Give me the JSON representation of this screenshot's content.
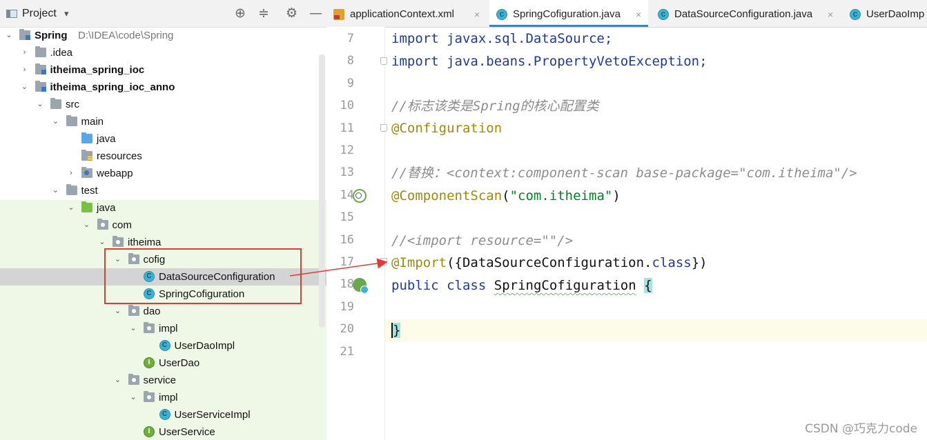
{
  "project_panel": {
    "title": "Project",
    "dropdown": "▾",
    "buttons": {
      "locate": "⊕",
      "collapse": "≑",
      "settings": "⚙",
      "hide": "—"
    },
    "tree": [
      {
        "label": "Spring",
        "path": "D:\\IDEA\\code\\Spring",
        "bold": true,
        "arrow": "⌄",
        "icon": "module",
        "indent": 0
      },
      {
        "label": ".idea",
        "arrow": "›",
        "icon": "folder",
        "indent": 1
      },
      {
        "label": "itheima_spring_ioc",
        "bold": true,
        "arrow": "›",
        "icon": "module",
        "indent": 1
      },
      {
        "label": "itheima_spring_ioc_anno",
        "bold": true,
        "arrow": "⌄",
        "icon": "module",
        "indent": 1
      },
      {
        "label": "src",
        "arrow": "⌄",
        "icon": "folder",
        "indent": 2
      },
      {
        "label": "main",
        "arrow": "⌄",
        "icon": "folder",
        "indent": 3
      },
      {
        "label": "java",
        "icon": "folder-blue",
        "indent": 4
      },
      {
        "label": "resources",
        "icon": "res",
        "indent": 4
      },
      {
        "label": "webapp",
        "arrow": "›",
        "icon": "web",
        "indent": 4
      },
      {
        "label": "test",
        "arrow": "⌄",
        "icon": "folder",
        "indent": 3
      },
      {
        "label": "java",
        "arrow": "⌄",
        "icon": "folder-green",
        "indent": 4
      },
      {
        "label": "com",
        "arrow": "⌄",
        "icon": "pkg",
        "indent": 5
      },
      {
        "label": "itheima",
        "arrow": "⌄",
        "icon": "pkg",
        "indent": 6
      },
      {
        "label": "cofig",
        "arrow": "⌄",
        "icon": "pkg",
        "indent": 7
      },
      {
        "label": "DataSourceConfiguration",
        "icon": "class",
        "indent": 8,
        "selected": true
      },
      {
        "label": "SpringCofiguration",
        "icon": "class",
        "indent": 8
      },
      {
        "label": "dao",
        "arrow": "⌄",
        "icon": "pkg",
        "indent": 7
      },
      {
        "label": "impl",
        "arrow": "⌄",
        "icon": "pkg",
        "indent": 8
      },
      {
        "label": "UserDaoImpl",
        "icon": "class",
        "indent": 9
      },
      {
        "label": "UserDao",
        "icon": "iface",
        "indent": 8
      },
      {
        "label": "service",
        "arrow": "⌄",
        "icon": "pkg",
        "indent": 7
      },
      {
        "label": "impl",
        "arrow": "⌄",
        "icon": "pkg",
        "indent": 8
      },
      {
        "label": "UserServiceImpl",
        "icon": "class",
        "indent": 9
      },
      {
        "label": "UserService",
        "icon": "iface",
        "indent": 8
      }
    ]
  },
  "tabs": [
    {
      "label": "applicationContext.xml",
      "icon": "xml",
      "close": "×"
    },
    {
      "label": "SpringCofiguration.java",
      "icon": "class",
      "close": "×",
      "active": true
    },
    {
      "label": "DataSourceConfiguration.java",
      "icon": "class",
      "close": "×"
    },
    {
      "label": "UserDaoImp",
      "icon": "class"
    }
  ],
  "editor": {
    "line_numbers": [
      "7",
      "8",
      "9",
      "10",
      "11",
      "12",
      "13",
      "14",
      "15",
      "16",
      "17",
      "18",
      "19",
      "20",
      "21"
    ],
    "lines": {
      "l7": "import javax.sql.DataSource;",
      "l8": "import java.beans.PropertyVetoException;",
      "l10": "//标志该类是Spring的核心配置类",
      "l11": "@Configuration",
      "l13": "//替换：<context:component-scan base-package=\"com.itheima\"/>",
      "l14_ann": "@ComponentScan",
      "l14_open": "(",
      "l14_str": "\"com.itheima\"",
      "l14_close": ")",
      "l16": "//<import resource=\"\"/>",
      "l17_ann": "@Import",
      "l17_mid": "({DataSourceConfiguration.",
      "l17_cls": "class",
      "l17_end": "})",
      "l18_kw1": "public",
      "l18_kw2": "class",
      "l18_name": "SpringCofiguration",
      "l18_brace": "{",
      "l20": "}"
    }
  },
  "watermark": "CSDN @巧克力code",
  "colors": {
    "annotation_red": "#e53935",
    "tab_accent": "#4083c9",
    "test_green_bg": "#eff7e7"
  }
}
